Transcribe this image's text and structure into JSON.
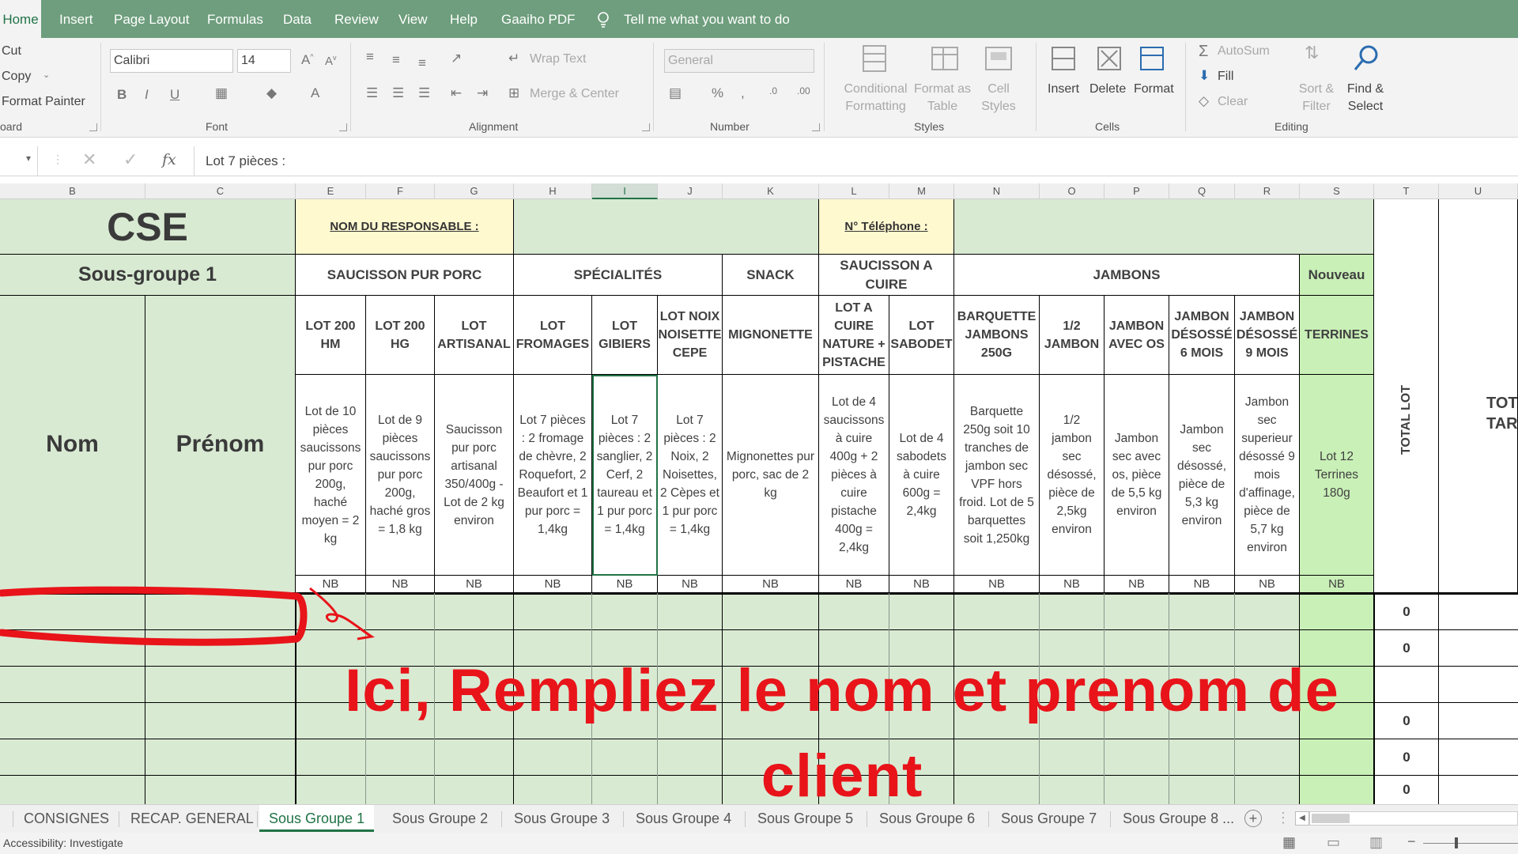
{
  "menu": {
    "tabs": [
      "Home",
      "Insert",
      "Page Layout",
      "Formulas",
      "Data",
      "Review",
      "View",
      "Help",
      "Gaaiho PDF"
    ],
    "tell_me": "Tell me what you want to do"
  },
  "ribbon": {
    "clipboard": {
      "cut": "Cut",
      "copy": "Copy",
      "format_painter": "Format Painter",
      "group": "oard"
    },
    "font": {
      "name": "Calibri",
      "size": "14",
      "group": "Font"
    },
    "alignment": {
      "wrap": "Wrap Text",
      "merge": "Merge & Center",
      "group": "Alignment"
    },
    "number": {
      "format": "General",
      "group": "Number"
    },
    "styles": {
      "conditional": "Conditional",
      "conditional2": "Formatting",
      "format_as": "Format as",
      "format_as2": "Table",
      "cell": "Cell",
      "cell2": "Styles",
      "group": "Styles"
    },
    "cells": {
      "insert": "Insert",
      "delete": "Delete",
      "format": "Format",
      "group": "Cells"
    },
    "editing": {
      "autosum": "AutoSum",
      "fill": "Fill",
      "clear": "Clear",
      "sort": "Sort &",
      "sort2": "Filter",
      "find": "Find &",
      "find2": "Select",
      "group": "Editing"
    }
  },
  "formula_bar": {
    "fx": "fx",
    "value": "Lot 7 pièces :"
  },
  "columns": [
    "B",
    "C",
    "E",
    "F",
    "G",
    "H",
    "I",
    "J",
    "K",
    "L",
    "M",
    "N",
    "O",
    "P",
    "Q",
    "R",
    "S",
    "T",
    "U"
  ],
  "sheet": {
    "title": "CSE",
    "subtitle": "Sous-groupe 1",
    "responsable_label": "NOM DU RESPONSABLE :",
    "telephone_label": "N° Téléphone :",
    "nom_label": "Nom",
    "prenom_label": "Prénom",
    "categories": [
      "SAUCISSON PUR PORC",
      "SPÉCIALITÉS",
      "SNACK",
      "SAUCISSON A CUIRE",
      "JAMBONS",
      "Nouveau"
    ],
    "products": [
      "LOT 200 HM",
      "LOT 200 HG",
      "LOT ARTISANAL",
      "LOT FROMAGES",
      "LOT GIBIERS",
      "LOT NOIX NOISETTE CEPE",
      "MIGNONETTE",
      "LOT A CUIRE NATURE + PISTACHE",
      "LOT SABODET",
      "BARQUETTE JAMBONS 250G",
      "1/2 JAMBON",
      "JAMBON AVEC OS",
      "JAMBON DÉSOSSÉ 6 MOIS",
      "JAMBON DÉSOSSÉ 9 MOIS",
      "TERRINES"
    ],
    "descriptions": [
      "Lot de 10 pièces saucissons pur porc 200g, haché moyen = 2 kg",
      "Lot de 9 pièces saucissons pur porc 200g, haché gros = 1,8 kg",
      "Saucisson pur porc artisanal 350/400g - Lot de 2 kg environ",
      "Lot 7 pièces : 2 fromage de chèvre, 2 Roquefort, 2 Beaufort et 1 pur porc = 1,4kg",
      "Lot 7 pièces : 2 sanglier, 2 Cerf, 2 taureau et 1 pur porc = 1,4kg",
      "Lot 7 pièces : 2 Noix, 2 Noisettes, 2 Cèpes et 1 pur porc = 1,4kg",
      "Mignonettes pur porc, sac de 2 kg",
      "Lot de 4 saucissons à cuire 400g + 2 pièces à cuire pistache 400g = 2,4kg",
      "Lot de 4 sabodets à cuire 600g = 2,4kg",
      "Barquette 250g soit 10 tranches de jambon sec VPF hors froid. Lot de 5 barquettes soit 1,250kg",
      "1/2 jambon sec désossé, pièce de 2,5kg environ",
      "Jambon sec avec os, pièce de 5,5 kg environ",
      "Jambon sec désossé, pièce de 5,3 kg environ",
      "Jambon sec superieur désossé 9 mois d'affinage, pièce de 5,7 kg environ",
      "Lot 12 Terrines 180g"
    ],
    "unit": "NB",
    "total_lot_label": "TOTAL LOT",
    "total_tarif_label_1": "TOTA",
    "total_tarif_label_2": "TAR",
    "row_totals": [
      "0",
      "0",
      "0",
      "0",
      "0"
    ]
  },
  "annotation": {
    "text": "Ici, Rempliez le nom et prenom de client",
    "color": "#e8141a"
  },
  "sheet_tabs": [
    "CONSIGNES",
    "RECAP. GENERAL",
    "Sous Groupe 1",
    "Sous Groupe 2",
    "Sous Groupe 3",
    "Sous Groupe 4",
    "Sous Groupe 5",
    "Sous Groupe 6",
    "Sous Groupe 7",
    "Sous Groupe 8 ..."
  ],
  "status": {
    "accessibility": "Accessibility: Investigate"
  }
}
